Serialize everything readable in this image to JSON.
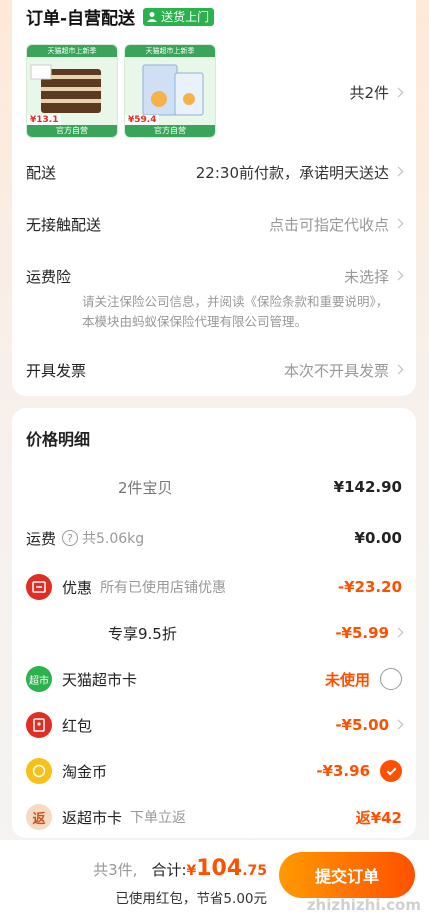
{
  "order": {
    "title": "订单-自营配送",
    "badge": "送货上门",
    "thumb1": {
      "banner": "天猫超市上新季",
      "price": "¥13.1",
      "footer": "官方自营"
    },
    "thumb2": {
      "banner": "天猫超市上新季",
      "price": "¥59.4",
      "footer": "官方自营"
    },
    "count": "共2件"
  },
  "rows": {
    "delivery": {
      "label": "配送",
      "value": "22:30前付款，承诺明天送达"
    },
    "contactless": {
      "label": "无接触配送",
      "value": "点击可指定代收点"
    },
    "insurance": {
      "label": "运费险",
      "value": "未选择",
      "note": "请关注保险公司信息，并阅读《保险条款和重要说明》，本模块由蚂蚁保保险代理有限公司管理。"
    },
    "invoice": {
      "label": "开具发票",
      "value": "本次不开具发票"
    }
  },
  "price": {
    "title": "价格明细",
    "goods": {
      "label": "2件宝贝",
      "amount": "¥142.90"
    },
    "shipping": {
      "label": "运费",
      "help_icon": "question-icon",
      "weight": "共5.06kg",
      "amount": "¥0.00"
    },
    "discount": {
      "label": "优惠",
      "sub": "所有已使用店铺优惠",
      "amount": "-¥23.20"
    },
    "exclusive": {
      "label": "专享9.5折",
      "amount": "-¥5.99"
    },
    "tmall_card": {
      "icon_text": "超市",
      "label": "天猫超市卡",
      "amount": "未使用"
    },
    "red_packet": {
      "label": "红包",
      "amount": "-¥5.00"
    },
    "gold_coin": {
      "label": "淘金币",
      "amount": "-¥3.96"
    },
    "return_card": {
      "icon_text": "返",
      "label": "返超市卡",
      "sub": "下单立返",
      "amount": "返¥42"
    }
  },
  "footer": {
    "qty": "共3件,",
    "total_label": "合计:",
    "currency": "¥",
    "total_int": "104",
    "total_dec": ".75",
    "saving": "已使用红包，节省5.00元",
    "submit": "提交订单",
    "watermark": "zhizhizhi.com"
  },
  "colors": {
    "accent": "#ff5000",
    "green": "#2bb24c",
    "red": "#e02e24"
  }
}
